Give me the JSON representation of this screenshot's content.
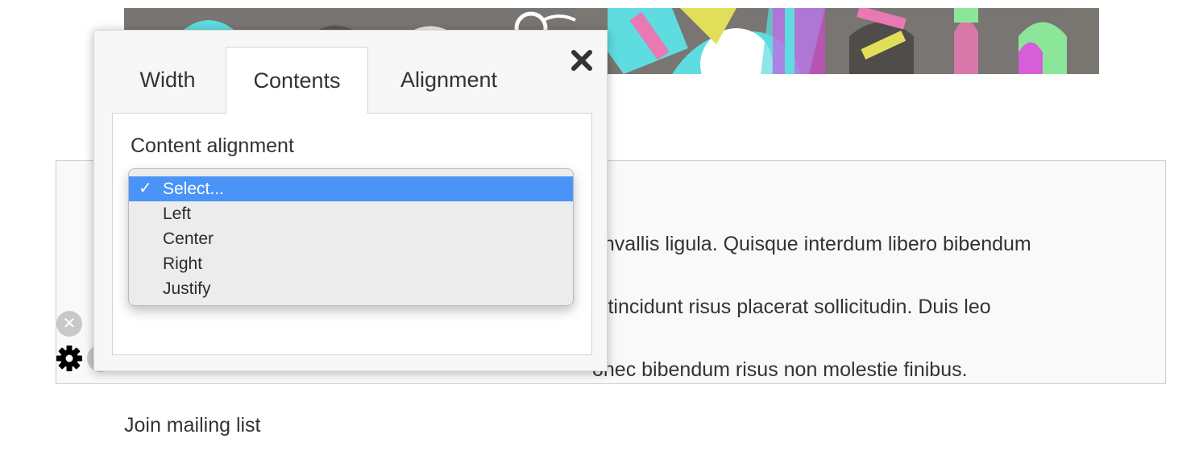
{
  "dialog": {
    "tabs": [
      {
        "label": "Width",
        "active": false
      },
      {
        "label": "Contents",
        "active": true
      },
      {
        "label": "Alignment",
        "active": false
      }
    ],
    "close_icon": "close-icon",
    "content_alignment": {
      "label": "Content alignment",
      "selected_value": "Select...",
      "options": [
        "Select...",
        "Left",
        "Center",
        "Right",
        "Justify"
      ],
      "selected_color": "#4a94f8"
    }
  },
  "section": {
    "body_text_lines": [
      "onvallis ligula. Quisque interdum libero bibendum",
      "c tincidunt risus placerat sollicitudin. Duis leo",
      "onec bibendum risus non molestie finibus."
    ],
    "remove_icon": "remove-icon",
    "settings_icon": "gear-icon"
  },
  "footer": {
    "mailing_label": "Join mailing list"
  },
  "colors": {
    "banner_pink": "#e879b3",
    "banner_cyan": "#5fdce0",
    "banner_yellow": "#e1df59",
    "banner_green": "#8ce69a",
    "banner_magenta": "#e93ce7",
    "banner_grey": "#6f6c6a"
  }
}
